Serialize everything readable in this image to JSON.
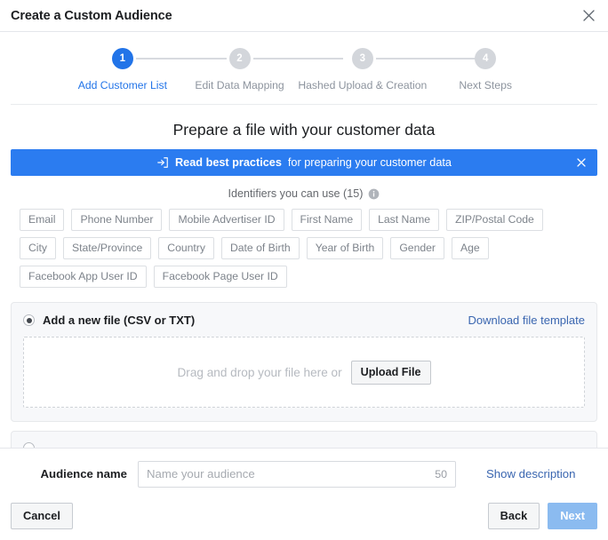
{
  "dialog": {
    "title": "Create a Custom Audience",
    "close_icon": "close-icon"
  },
  "stepper": {
    "steps": [
      {
        "number": "1",
        "label": "Add Customer List",
        "active": true
      },
      {
        "number": "2",
        "label": "Edit Data Mapping",
        "active": false
      },
      {
        "number": "3",
        "label": "Hashed Upload & Creation",
        "active": false
      },
      {
        "number": "4",
        "label": "Next Steps",
        "active": false
      }
    ],
    "active_color": "#2274e8",
    "inactive_color": "#d3d6db"
  },
  "main": {
    "heading": "Prepare a file with your customer data",
    "banner": {
      "icon": "external-link-icon",
      "strong_text": "Read best practices",
      "rest_text": "for preparing your customer data",
      "close_icon": "close-icon",
      "background": "#2b7cf0"
    },
    "identifiers": {
      "heading": "Identifiers you can use (15)",
      "info_icon": "info-icon",
      "rows": [
        [
          "Email",
          "Phone Number",
          "Mobile Advertiser ID",
          "First Name",
          "Last Name",
          "ZIP/Postal Code"
        ],
        [
          "City",
          "State/Province",
          "Country",
          "Date of Birth",
          "Year of Birth",
          "Gender",
          "Age"
        ],
        [
          "Facebook App User ID",
          "Facebook Page User ID"
        ]
      ]
    },
    "upload_panel": {
      "radio_label": "Add a new file (CSV or TXT)",
      "radio_checked": true,
      "template_link": "Download file template",
      "dropzone_text": "Drag and drop your file here or",
      "upload_button": "Upload File"
    }
  },
  "footer": {
    "audience_name_label": "Audience name",
    "audience_name_value": "",
    "audience_name_placeholder": "Name your audience",
    "character_counter": "50",
    "show_description": "Show description",
    "cancel_button": "Cancel",
    "back_button": "Back",
    "next_button": "Next",
    "next_button_color": "#8bbbf0"
  }
}
